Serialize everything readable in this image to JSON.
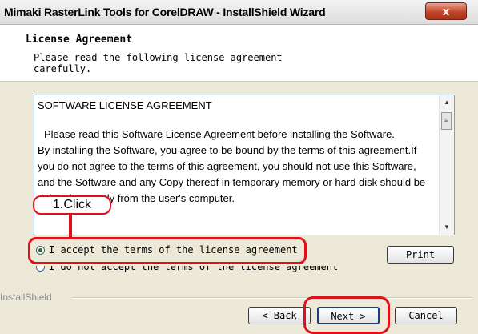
{
  "window": {
    "title": "Mimaki RasterLink Tools for CorelDRAW - InstallShield Wizard",
    "close_glyph": "x"
  },
  "header": {
    "title": "License Agreement",
    "description": "Please read the following license agreement carefully."
  },
  "license": {
    "title": "SOFTWARE LICENSE AGREEMENT",
    "para1": "Please read this Software License Agreement before installing the Software.",
    "para2": "By installing the Software, you agree to be bound by the terms of this agreement.If you do not agree to the terms of this agreement, you should not use this Software, and the Software and any Copy thereof in temporary memory or hard disk should be deleted promptly from the user's computer."
  },
  "options": {
    "accept_label": "I accept the terms of the license agreement",
    "decline_label": "I do not accept the terms of the license agreement",
    "selected": "accept"
  },
  "buttons": {
    "print": "Print",
    "back": "< Back",
    "next": "Next >",
    "cancel": "Cancel"
  },
  "footer": {
    "brand": "InstallShield"
  },
  "annotation": {
    "callout": "1.Click",
    "highlight_color": "#e0101a"
  }
}
